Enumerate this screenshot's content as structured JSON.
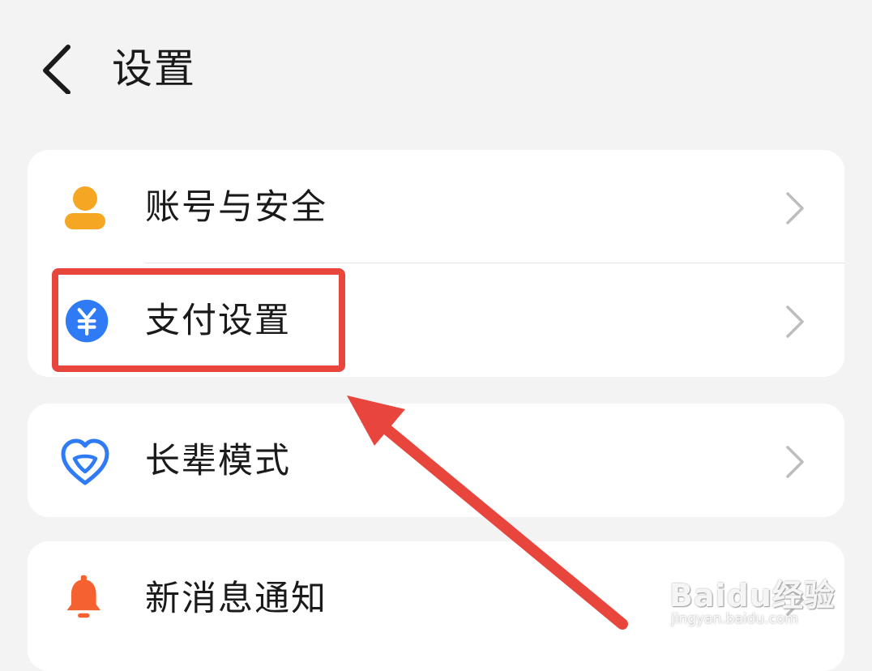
{
  "header": {
    "title": "设置",
    "back_icon": "chevron-left-icon"
  },
  "groups": [
    {
      "items": [
        {
          "label": "账号与安全",
          "icon": "user-icon",
          "color": "#f5a623"
        },
        {
          "label": "支付设置",
          "icon": "yuan-icon",
          "color": "#2f7bf5"
        }
      ]
    },
    {
      "items": [
        {
          "label": "长辈模式",
          "icon": "heart-icon",
          "color": "#2f7bf5"
        }
      ]
    },
    {
      "items": [
        {
          "label": "新消息通知",
          "icon": "bell-icon",
          "color": "#f5622f"
        }
      ]
    }
  ],
  "annotation": {
    "highlight_color": "#e8453c"
  },
  "watermark": {
    "logo": "Baidu经验",
    "url": "jingyan.baidu.com"
  }
}
